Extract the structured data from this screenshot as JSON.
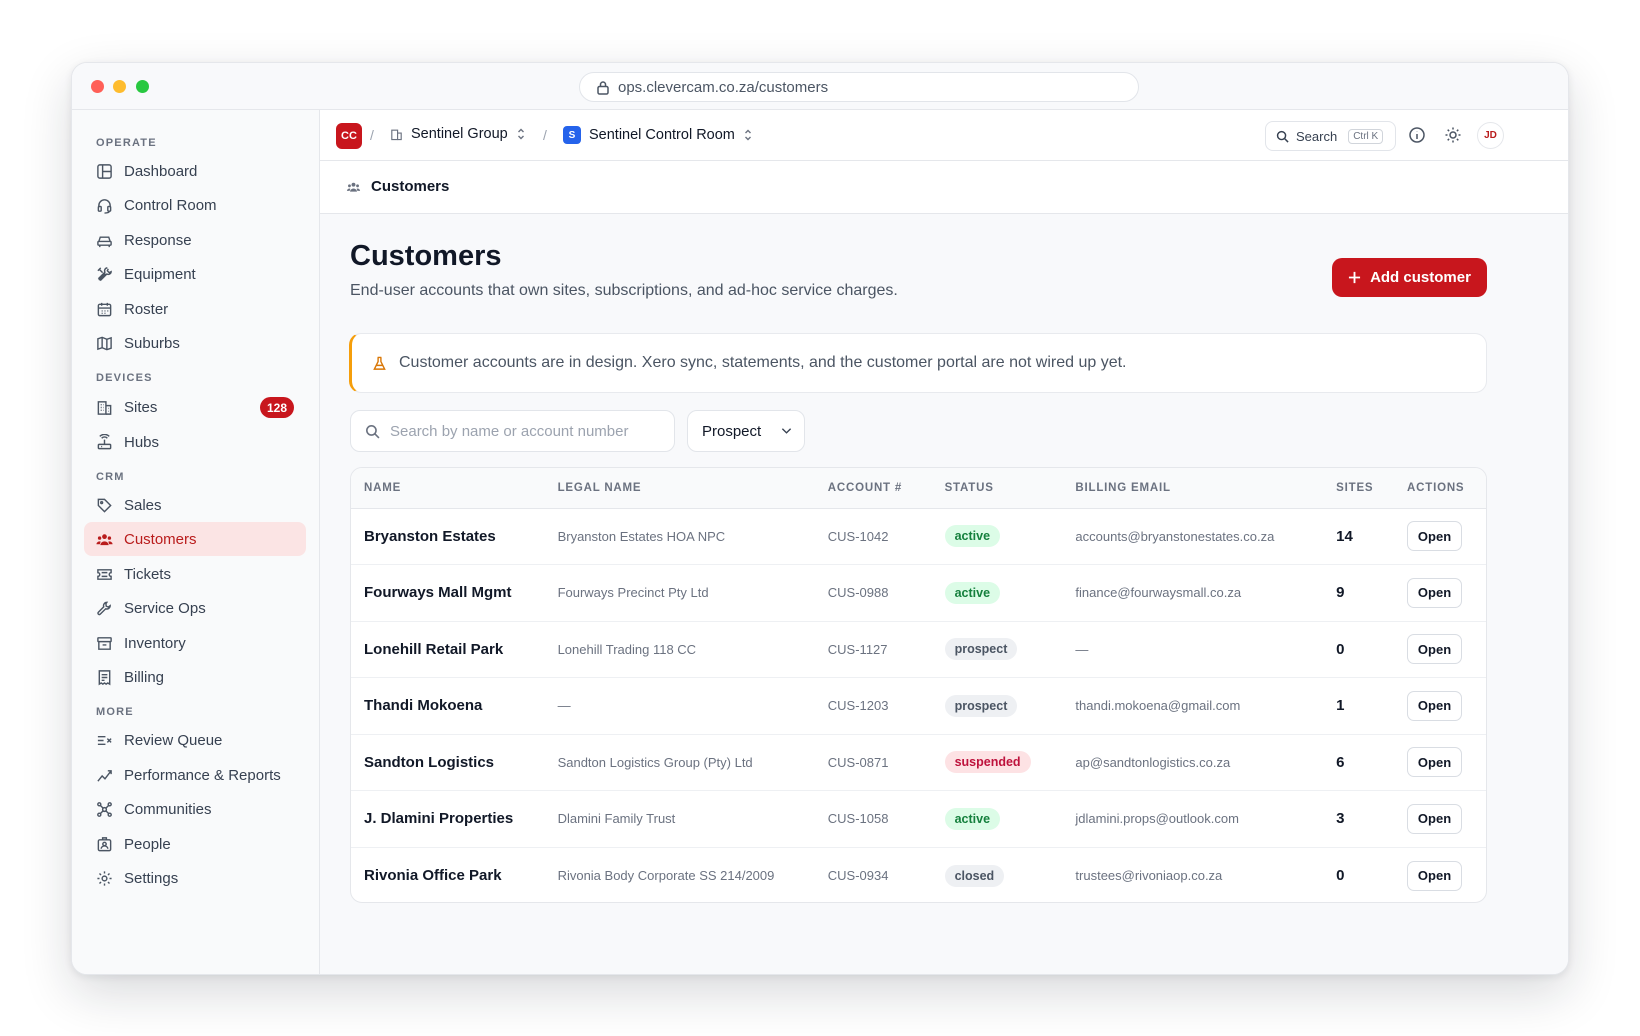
{
  "browser": {
    "url": "ops.clevercam.co.za/customers"
  },
  "sidebar": {
    "sections": [
      {
        "label": "OPERATE",
        "items": [
          {
            "label": "Dashboard",
            "icon": "dashboard-icon"
          },
          {
            "label": "Control Room",
            "icon": "headset-icon"
          },
          {
            "label": "Response",
            "icon": "car-icon"
          },
          {
            "label": "Equipment",
            "icon": "tools-icon"
          },
          {
            "label": "Roster",
            "icon": "calendar-icon"
          },
          {
            "label": "Suburbs",
            "icon": "map-icon"
          }
        ]
      },
      {
        "label": "DEVICES",
        "items": [
          {
            "label": "Sites",
            "icon": "building-icon",
            "badge": "128"
          },
          {
            "label": "Hubs",
            "icon": "router-icon"
          }
        ]
      },
      {
        "label": "CRM",
        "items": [
          {
            "label": "Sales",
            "icon": "tag-icon"
          },
          {
            "label": "Customers",
            "icon": "users-icon",
            "active": true
          },
          {
            "label": "Tickets",
            "icon": "ticket-icon"
          },
          {
            "label": "Service Ops",
            "icon": "wrench-icon"
          },
          {
            "label": "Inventory",
            "icon": "archive-icon"
          },
          {
            "label": "Billing",
            "icon": "receipt-icon"
          }
        ]
      },
      {
        "label": "MORE",
        "items": [
          {
            "label": "Review Queue",
            "icon": "list-check-icon"
          },
          {
            "label": "Performance & Reports",
            "icon": "chart-line-icon"
          },
          {
            "label": "Communities",
            "icon": "network-icon"
          },
          {
            "label": "People",
            "icon": "id-badge-icon"
          },
          {
            "label": "Settings",
            "icon": "gear-icon"
          }
        ]
      }
    ]
  },
  "topbar": {
    "org_logo": "CC",
    "org_name": "Sentinel Group",
    "workspace_logo": "S",
    "workspace_name": "Sentinel Control Room",
    "search_label": "Search",
    "search_shortcut": "Ctrl K",
    "avatar_initials": "JD"
  },
  "subbar": {
    "title": "Customers"
  },
  "page": {
    "title": "Customers",
    "subtitle": "End-user accounts that own sites, subscriptions, and ad-hoc service charges.",
    "add_button": "Add customer",
    "notice": "Customer accounts are in design. Xero sync, statements, and the customer portal are not wired up yet.",
    "search_placeholder": "Search by name or account number",
    "filter_value": "Prospect"
  },
  "table": {
    "headers": [
      "NAME",
      "LEGAL NAME",
      "ACCOUNT #",
      "STATUS",
      "BILLING EMAIL",
      "SITES",
      "ACTIONS"
    ],
    "action_label": "Open",
    "rows": [
      {
        "name": "Bryanston Estates",
        "legal": "Bryanston Estates HOA NPC",
        "account": "CUS-1042",
        "status": "active",
        "email": "accounts@bryanstonestates.co.za",
        "sites": "14"
      },
      {
        "name": "Fourways Mall Mgmt",
        "legal": "Fourways Precinct Pty Ltd",
        "account": "CUS-0988",
        "status": "active",
        "email": "finance@fourwaysmall.co.za",
        "sites": "9"
      },
      {
        "name": "Lonehill Retail Park",
        "legal": "Lonehill Trading 118 CC",
        "account": "CUS-1127",
        "status": "prospect",
        "email": "—",
        "sites": "0"
      },
      {
        "name": "Thandi Mokoena",
        "legal": "—",
        "account": "CUS-1203",
        "status": "prospect",
        "email": "thandi.mokoena@gmail.com",
        "sites": "1"
      },
      {
        "name": "Sandton Logistics",
        "legal": "Sandton Logistics Group (Pty) Ltd",
        "account": "CUS-0871",
        "status": "suspended",
        "email": "ap@sandtonlogistics.co.za",
        "sites": "6"
      },
      {
        "name": "J. Dlamini Properties",
        "legal": "Dlamini Family Trust",
        "account": "CUS-1058",
        "status": "active",
        "email": "jdlamini.props@outlook.com",
        "sites": "3"
      },
      {
        "name": "Rivonia Office Park",
        "legal": "Rivonia Body Corporate SS 214/2009",
        "account": "CUS-0934",
        "status": "closed",
        "email": "trustees@rivoniaop.co.za",
        "sites": "0"
      }
    ]
  },
  "colors": {
    "brand": "#c8161d",
    "active_nav_bg": "#fbe4e4",
    "notice_accent": "#f59e0b"
  }
}
